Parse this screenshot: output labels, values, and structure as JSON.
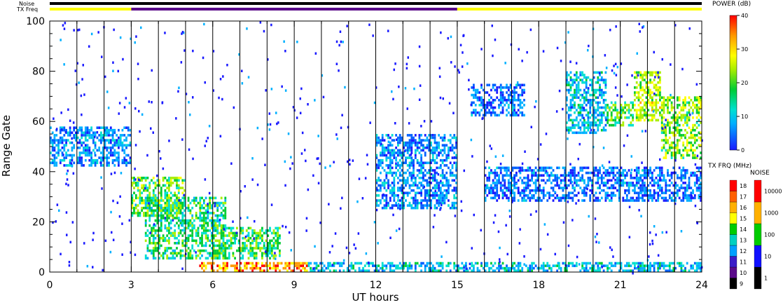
{
  "chart_data": {
    "type": "heatmap",
    "xlabel": "UT hours",
    "ylabel": "Range Gate",
    "xlim": [
      0,
      24
    ],
    "ylim": [
      0,
      100
    ],
    "xticks": [
      0,
      3,
      6,
      9,
      12,
      15,
      18,
      21,
      24
    ],
    "yticks": [
      0,
      20,
      40,
      60,
      80,
      100
    ],
    "scan_lines_x": [
      1,
      2,
      3,
      4,
      5,
      6,
      7,
      8,
      9,
      10,
      11,
      12,
      13,
      14,
      15,
      16,
      17,
      18,
      19,
      20,
      21,
      22,
      23,
      24
    ],
    "top_bars": {
      "noise_label": "Noise",
      "txfreq_label": "TX Freq",
      "noise_color": "#000000",
      "txfreq_segments": [
        {
          "start": 0,
          "end": 3,
          "color": "#ffff00"
        },
        {
          "start": 3,
          "end": 15,
          "color": "#5a0a8a"
        },
        {
          "start": 15,
          "end": 24,
          "color": "#ffff00"
        }
      ]
    },
    "echo_regions": [
      {
        "x0": 0.0,
        "x1": 3.0,
        "y0": 42,
        "y1": 58,
        "level": 8,
        "note": "band"
      },
      {
        "x0": 3.0,
        "x1": 5.0,
        "y0": 22,
        "y1": 38,
        "level": 22
      },
      {
        "x0": 3.5,
        "x1": 6.5,
        "y0": 5,
        "y1": 30,
        "level": 18
      },
      {
        "x0": 5.5,
        "x1": 9.5,
        "y0": 0,
        "y1": 4,
        "level": 34
      },
      {
        "x0": 6.0,
        "x1": 8.5,
        "y0": 5,
        "y1": 18,
        "level": 20
      },
      {
        "x0": 9.5,
        "x1": 24.0,
        "y0": 0,
        "y1": 4,
        "level": 12
      },
      {
        "x0": 12.0,
        "x1": 15.0,
        "y0": 25,
        "y1": 55,
        "level": 8
      },
      {
        "x0": 15.5,
        "x1": 17.5,
        "y0": 62,
        "y1": 75,
        "level": 6
      },
      {
        "x0": 16.0,
        "x1": 24.0,
        "y0": 28,
        "y1": 42,
        "level": 6
      },
      {
        "x0": 19.0,
        "x1": 20.5,
        "y0": 55,
        "y1": 80,
        "level": 12
      },
      {
        "x0": 20.5,
        "x1": 21.5,
        "y0": 58,
        "y1": 68,
        "level": 20
      },
      {
        "x0": 21.5,
        "x1": 22.5,
        "y0": 60,
        "y1": 80,
        "level": 26
      },
      {
        "x0": 22.5,
        "x1": 24.0,
        "y0": 45,
        "y1": 70,
        "level": 24
      }
    ],
    "colorbars": {
      "power": {
        "title": "POWER (dB)",
        "ticks": [
          "0",
          "10",
          "20",
          "30",
          "40"
        ]
      },
      "txfreq": {
        "title": "TX FRQ (MHz)",
        "ticks": [
          "9",
          "10",
          "11",
          "12",
          "13",
          "14",
          "15",
          "16",
          "17",
          "18"
        ],
        "colors": [
          "#000000",
          "#5a0a8a",
          "#3a1cc8",
          "#00a0ff",
          "#00d0c0",
          "#00cc00",
          "#ffff00",
          "#ffb000",
          "#ff6000",
          "#ff0000"
        ]
      },
      "noise": {
        "title": "NOISE",
        "ticks": [
          "1",
          "10",
          "100",
          "1000",
          "10000"
        ],
        "colors": [
          "#000000",
          "#1010ff",
          "#00cc00",
          "#ffb000",
          "#ff0000"
        ]
      }
    }
  }
}
